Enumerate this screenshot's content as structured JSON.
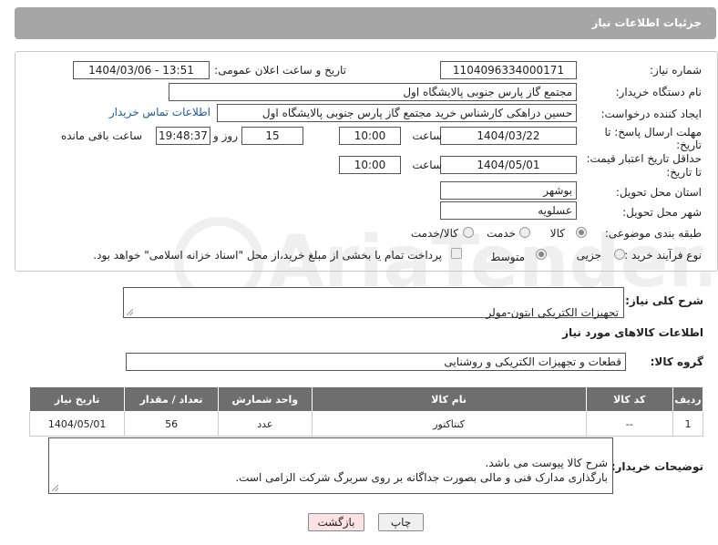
{
  "header": {
    "title": "جزئیات اطلاعات نیاز"
  },
  "fields": {
    "need_number_label": "شماره نیاز:",
    "need_number": "1104096334000171",
    "announce_label": "تاریخ و ساعت اعلان عمومی:",
    "announce_value": "1404/03/06 - 13:51",
    "buyer_org_label": "نام دستگاه خریدار:",
    "buyer_org": "مجتمع گاز پارس جنوبی  پالایشگاه اول",
    "creator_label": "ایجاد کننده درخواست:",
    "creator": "حسین دراهکی کارشناس خرید مجتمع گاز پارس جنوبی  پالایشگاه اول",
    "contact_link": "اطلاعات تماس خریدار",
    "deadline_label_1": "مهلت ارسال پاسخ: تا",
    "deadline_label_2": "تاریخ:",
    "deadline_date": "1404/03/22",
    "time_label": "ساعت",
    "deadline_time": "10:00",
    "days_value": "15",
    "days_label": "روز و",
    "remaining_time": "19:48:37",
    "remaining_label": "ساعت باقی مانده",
    "validity_label_1": "حداقل تاریخ اعتبار قیمت:",
    "validity_label_2": "تا تاریخ:",
    "validity_date": "1404/05/01",
    "validity_time": "10:00",
    "province_label": "استان محل تحویل:",
    "province": "بوشهر",
    "city_label": "شهر محل تحویل:",
    "city": "عسلویه",
    "category_label": "طبقه بندی موضوعی:",
    "category_options": [
      "کالا",
      "خدمت",
      "کالا/خدمت"
    ],
    "process_label": "نوع فرآیند خرید :",
    "process_options": [
      "جزیی",
      "متوسط"
    ],
    "payment_note": "پرداخت تمام یا بخشی از مبلغ خرید،از محل \"اسناد خزانه اسلامی\" خواهد بود."
  },
  "description": {
    "label": "شرح کلی نیاز:",
    "value": "تجهیزات الکتریکی ایتون-مولر"
  },
  "goods_section_title": "اطلاعات کالاهای مورد نیاز",
  "goods_group": {
    "label": "گروه کالا:",
    "value": "قطعات و تجهیزات الکتریکی و روشنایی"
  },
  "table": {
    "headers": [
      "ردیف",
      "کد کالا",
      "نام کالا",
      "واحد شمارش",
      "تعداد / مقدار",
      "تاریخ نیاز"
    ],
    "rows": [
      [
        "1",
        "--",
        "کنتاکتور",
        "عدد",
        "56",
        "1404/05/01"
      ]
    ]
  },
  "buyer_notes": {
    "label": "توضیحات خریدار:",
    "value": "شرح کالا پیوست می باشد.\nبارگذاری مدارک فنی و مالی بصورت جداگانه بر روی سربرگ شرکت الزامی است."
  },
  "buttons": {
    "print": "چاپ",
    "back": "بازگشت"
  },
  "colors": {
    "header_bg": "#a6a6a6",
    "table_header_bg": "#6e6e6e",
    "link": "#1a5aa8",
    "back_button_bg": "#fbe3e3"
  },
  "watermark_text": "AriaTender.neT"
}
